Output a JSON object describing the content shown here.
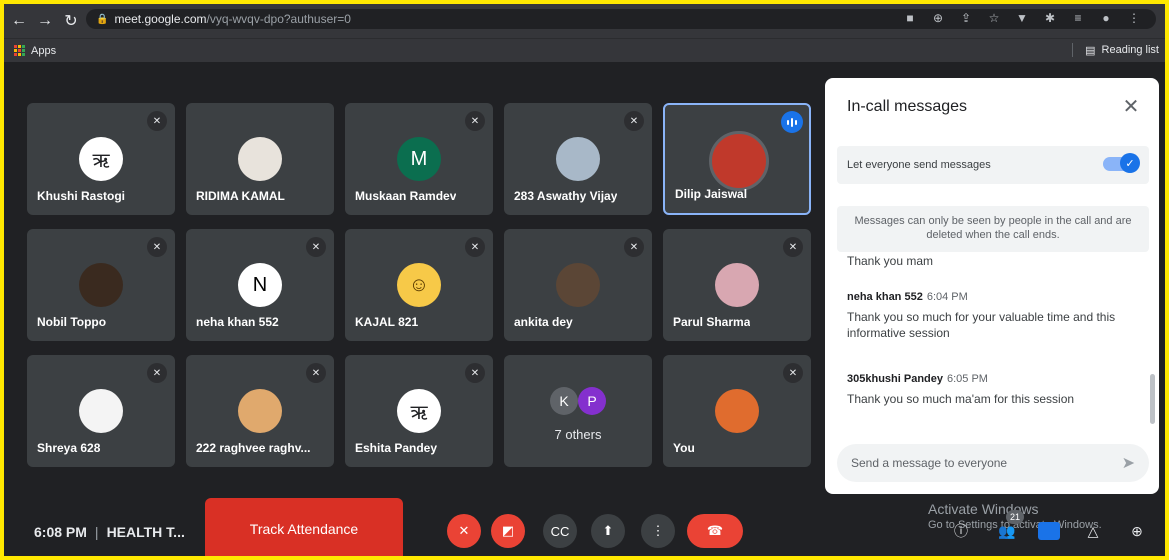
{
  "browser": {
    "url_host": "meet.google.com",
    "url_path": "/vyq-wvqv-dpo?authuser=0",
    "bookmarks": {
      "apps_label": "Apps",
      "reading_list_label": "Reading list"
    }
  },
  "participants": [
    {
      "name": "Khushi Rastogi",
      "avatar_text": "ऋ",
      "avatar_bg": "#ffffff",
      "avatar_fg": "#202124",
      "muted": true
    },
    {
      "name": "RIDIMA KAMAL",
      "avatar_text": "",
      "avatar_bg": "#e8e3dc",
      "avatar_fg": "#202124",
      "muted": false
    },
    {
      "name": "Muskaan Ramdev",
      "avatar_text": "M",
      "avatar_bg": "#0b6e4f",
      "avatar_fg": "#ffffff",
      "muted": true
    },
    {
      "name": "283 Aswathy Vijay",
      "avatar_text": "",
      "avatar_bg": "#a8b8c8",
      "avatar_fg": "#202124",
      "muted": true
    },
    {
      "name": "Dilip Jaiswal",
      "avatar_text": "",
      "avatar_bg": "#c0392b",
      "avatar_fg": "#ffffff",
      "muted": false,
      "speaking": true
    },
    {
      "name": "Nobil Toppo",
      "avatar_text": "",
      "avatar_bg": "#3a2a1f",
      "avatar_fg": "#ffffff",
      "muted": true
    },
    {
      "name": "neha khan 552",
      "avatar_text": "N",
      "avatar_bg": "#ffffff",
      "avatar_fg": "#000000",
      "muted": true
    },
    {
      "name": "KAJAL 821",
      "avatar_text": "☺",
      "avatar_bg": "#f7c948",
      "avatar_fg": "#5a3b00",
      "muted": true
    },
    {
      "name": "ankita dey",
      "avatar_text": "",
      "avatar_bg": "#5b4636",
      "avatar_fg": "#ffffff",
      "muted": true
    },
    {
      "name": "Parul Sharma",
      "avatar_text": "",
      "avatar_bg": "#d8a7b1",
      "avatar_fg": "#202124",
      "muted": true
    },
    {
      "name": "Shreya 628",
      "avatar_text": "",
      "avatar_bg": "#f4f4f4",
      "avatar_fg": "#202124",
      "muted": true
    },
    {
      "name": "222 raghvee raghv...",
      "avatar_text": "",
      "avatar_bg": "#e0a96d",
      "avatar_fg": "#202124",
      "muted": true
    },
    {
      "name": "Eshita Pandey",
      "avatar_text": "ऋ",
      "avatar_bg": "#ffffff",
      "avatar_fg": "#202124",
      "muted": true
    },
    {
      "name": "7 others",
      "others": true,
      "muted": false
    },
    {
      "name": "You",
      "avatar_text": "",
      "avatar_bg": "#e06c2e",
      "avatar_fg": "#ffffff",
      "muted": true
    }
  ],
  "others_group": {
    "label": "7 others",
    "initials": [
      {
        "letter": "K",
        "color": "#5f6368"
      },
      {
        "letter": "P",
        "color": "#8430ce"
      }
    ]
  },
  "panel": {
    "title": "In-call messages",
    "setting_label": "Let everyone send messages",
    "setting_enabled": true,
    "info": "Messages can only be seen by people in the call and are deleted when the call ends.",
    "cut_message": "Thank you mam",
    "messages": [
      {
        "sender": "neha khan 552",
        "time": "6:04 PM",
        "text": "Thank you so much for your valuable time and this informative session"
      },
      {
        "sender": "305khushi Pandey",
        "time": "6:05 PM",
        "text": "Thank you so much ma'am for this session"
      }
    ],
    "input_placeholder": "Send a message to everyone"
  },
  "bottom": {
    "time": "6:08 PM",
    "meeting_title": "HEALTH T...",
    "track_attendance": "Track Attendance",
    "watermark_line1": "Activate Windows",
    "watermark_line2": "Go to Settings to activate Windows.",
    "people_count": "21"
  }
}
